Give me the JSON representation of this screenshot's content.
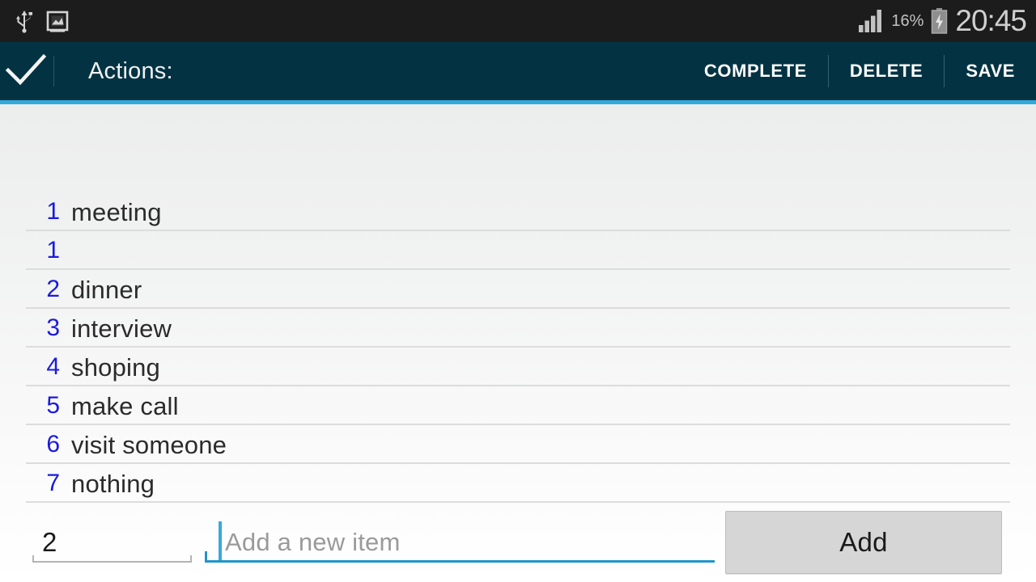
{
  "statusbar": {
    "left_icons": [
      "usb-icon",
      "screenshot-image-icon"
    ],
    "battery_percent": "16%",
    "battery_icon": "battery-charging-icon",
    "signal_icon": "signal-bars-icon",
    "clock": "20:45"
  },
  "actionbar": {
    "home_icon": "checkmark-icon",
    "title": "Actions:",
    "buttons": [
      {
        "label": "COMPLETE",
        "name": "complete-button"
      },
      {
        "label": "DELETE",
        "name": "delete-button"
      },
      {
        "label": "SAVE",
        "name": "save-button"
      }
    ],
    "background_color": "#033343",
    "accent_color": "#33aadd"
  },
  "list": {
    "number_color": "#1a1ae0",
    "items": [
      {
        "number": "1",
        "text": "meeting"
      },
      {
        "number": "1",
        "text": ""
      },
      {
        "number": "2",
        "text": "dinner"
      },
      {
        "number": "3",
        "text": "interview"
      },
      {
        "number": "4",
        "text": "shoping"
      },
      {
        "number": "5",
        "text": "make call"
      },
      {
        "number": "6",
        "text": "visit someone"
      },
      {
        "number": "7",
        "text": "nothing"
      }
    ]
  },
  "entry": {
    "quantity_value": "2",
    "new_item_placeholder": "Add a new item",
    "new_item_value": "",
    "add_label": "Add",
    "focus_color": "#2196c9"
  }
}
